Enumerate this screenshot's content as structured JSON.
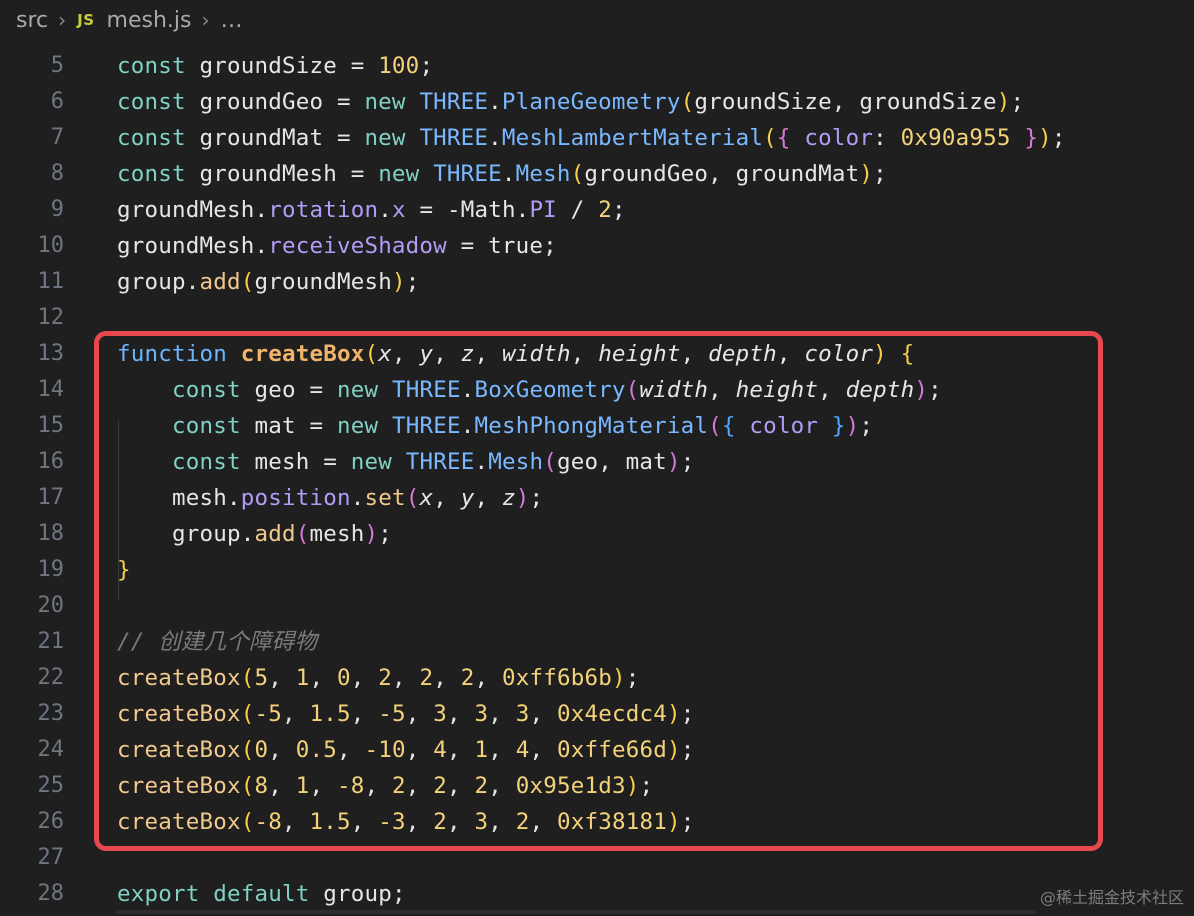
{
  "breadcrumb": {
    "folder": "src",
    "file_icon": "JS",
    "file": "mesh.js",
    "more": "…"
  },
  "colors": {
    "highlight_border": "#e5484d",
    "background": "#1f1f1f"
  },
  "lines": [
    {
      "n": "5",
      "tokens": [
        [
          "kw",
          "const"
        ],
        [
          "plain",
          " groundSize = "
        ],
        [
          "num",
          "100"
        ],
        [
          "plain",
          ";"
        ]
      ]
    },
    {
      "n": "6",
      "tokens": [
        [
          "kw",
          "const"
        ],
        [
          "plain",
          " groundGeo = "
        ],
        [
          "kw",
          "new"
        ],
        [
          "plain",
          " "
        ],
        [
          "cls",
          "THREE"
        ],
        [
          "plain",
          "."
        ],
        [
          "cls",
          "PlaneGeometry"
        ],
        [
          "b1",
          "("
        ],
        [
          "plain",
          "groundSize, groundSize"
        ],
        [
          "b1",
          ")"
        ],
        [
          "plain",
          ";"
        ]
      ]
    },
    {
      "n": "7",
      "tokens": [
        [
          "kw",
          "const"
        ],
        [
          "plain",
          " groundMat = "
        ],
        [
          "kw",
          "new"
        ],
        [
          "plain",
          " "
        ],
        [
          "cls",
          "THREE"
        ],
        [
          "plain",
          "."
        ],
        [
          "cls",
          "MeshLambertMaterial"
        ],
        [
          "b1",
          "("
        ],
        [
          "b2",
          "{"
        ],
        [
          "plain",
          " "
        ],
        [
          "prop",
          "color"
        ],
        [
          "plain",
          ": "
        ],
        [
          "num",
          "0x90a955"
        ],
        [
          "plain",
          " "
        ],
        [
          "b2",
          "}"
        ],
        [
          "b1",
          ")"
        ],
        [
          "plain",
          ";"
        ]
      ]
    },
    {
      "n": "8",
      "tokens": [
        [
          "kw",
          "const"
        ],
        [
          "plain",
          " groundMesh = "
        ],
        [
          "kw",
          "new"
        ],
        [
          "plain",
          " "
        ],
        [
          "cls",
          "THREE"
        ],
        [
          "plain",
          "."
        ],
        [
          "cls",
          "Mesh"
        ],
        [
          "b1",
          "("
        ],
        [
          "plain",
          "groundGeo, groundMat"
        ],
        [
          "b1",
          ")"
        ],
        [
          "plain",
          ";"
        ]
      ]
    },
    {
      "n": "9",
      "tokens": [
        [
          "plain",
          "groundMesh."
        ],
        [
          "prop",
          "rotation"
        ],
        [
          "plain",
          "."
        ],
        [
          "prop",
          "x"
        ],
        [
          "plain",
          " = "
        ],
        [
          "plain",
          "-Math."
        ],
        [
          "prop",
          "PI"
        ],
        [
          "plain",
          " / "
        ],
        [
          "num",
          "2"
        ],
        [
          "plain",
          ";"
        ]
      ]
    },
    {
      "n": "10",
      "tokens": [
        [
          "plain",
          "groundMesh."
        ],
        [
          "prop",
          "receiveShadow"
        ],
        [
          "plain",
          " = "
        ],
        [
          "plain",
          "true"
        ],
        [
          "plain",
          ";"
        ]
      ]
    },
    {
      "n": "11",
      "tokens": [
        [
          "plain",
          "group."
        ],
        [
          "call",
          "add"
        ],
        [
          "b1",
          "("
        ],
        [
          "plain",
          "groundMesh"
        ],
        [
          "b1",
          ")"
        ],
        [
          "plain",
          ";"
        ]
      ]
    },
    {
      "n": "12",
      "tokens": []
    },
    {
      "n": "13",
      "tokens": [
        [
          "fnkw",
          "function"
        ],
        [
          "plain",
          " "
        ],
        [
          "fn",
          "createBox"
        ],
        [
          "b1",
          "("
        ],
        [
          "param",
          "x"
        ],
        [
          "plain",
          ", "
        ],
        [
          "param",
          "y"
        ],
        [
          "plain",
          ", "
        ],
        [
          "param",
          "z"
        ],
        [
          "plain",
          ", "
        ],
        [
          "param",
          "width"
        ],
        [
          "plain",
          ", "
        ],
        [
          "param",
          "height"
        ],
        [
          "plain",
          ", "
        ],
        [
          "param",
          "depth"
        ],
        [
          "plain",
          ", "
        ],
        [
          "param",
          "color"
        ],
        [
          "b1",
          ")"
        ],
        [
          "plain",
          " "
        ],
        [
          "b1",
          "{"
        ]
      ]
    },
    {
      "n": "14",
      "tokens": [
        [
          "plain",
          "    "
        ],
        [
          "kw",
          "const"
        ],
        [
          "plain",
          " geo = "
        ],
        [
          "kw",
          "new"
        ],
        [
          "plain",
          " "
        ],
        [
          "cls",
          "THREE"
        ],
        [
          "plain",
          "."
        ],
        [
          "cls",
          "BoxGeometry"
        ],
        [
          "b2",
          "("
        ],
        [
          "param",
          "width"
        ],
        [
          "plain",
          ", "
        ],
        [
          "param",
          "height"
        ],
        [
          "plain",
          ", "
        ],
        [
          "param",
          "depth"
        ],
        [
          "b2",
          ")"
        ],
        [
          "plain",
          ";"
        ]
      ]
    },
    {
      "n": "15",
      "tokens": [
        [
          "plain",
          "    "
        ],
        [
          "kw",
          "const"
        ],
        [
          "plain",
          " mat = "
        ],
        [
          "kw",
          "new"
        ],
        [
          "plain",
          " "
        ],
        [
          "cls",
          "THREE"
        ],
        [
          "plain",
          "."
        ],
        [
          "cls",
          "MeshPhongMaterial"
        ],
        [
          "b2",
          "("
        ],
        [
          "b3",
          "{"
        ],
        [
          "plain",
          " "
        ],
        [
          "prop",
          "color"
        ],
        [
          "plain",
          " "
        ],
        [
          "b3",
          "}"
        ],
        [
          "b2",
          ")"
        ],
        [
          "plain",
          ";"
        ]
      ]
    },
    {
      "n": "16",
      "tokens": [
        [
          "plain",
          "    "
        ],
        [
          "kw",
          "const"
        ],
        [
          "plain",
          " mesh = "
        ],
        [
          "kw",
          "new"
        ],
        [
          "plain",
          " "
        ],
        [
          "cls",
          "THREE"
        ],
        [
          "plain",
          "."
        ],
        [
          "cls",
          "Mesh"
        ],
        [
          "b2",
          "("
        ],
        [
          "plain",
          "geo, mat"
        ],
        [
          "b2",
          ")"
        ],
        [
          "plain",
          ";"
        ]
      ]
    },
    {
      "n": "17",
      "tokens": [
        [
          "plain",
          "    mesh."
        ],
        [
          "prop",
          "position"
        ],
        [
          "plain",
          "."
        ],
        [
          "call",
          "set"
        ],
        [
          "b2",
          "("
        ],
        [
          "param",
          "x"
        ],
        [
          "plain",
          ", "
        ],
        [
          "param",
          "y"
        ],
        [
          "plain",
          ", "
        ],
        [
          "param",
          "z"
        ],
        [
          "b2",
          ")"
        ],
        [
          "plain",
          ";"
        ]
      ]
    },
    {
      "n": "18",
      "tokens": [
        [
          "plain",
          "    group."
        ],
        [
          "call",
          "add"
        ],
        [
          "b2",
          "("
        ],
        [
          "plain",
          "mesh"
        ],
        [
          "b2",
          ")"
        ],
        [
          "plain",
          ";"
        ]
      ]
    },
    {
      "n": "19",
      "tokens": [
        [
          "b1",
          "}"
        ]
      ]
    },
    {
      "n": "20",
      "tokens": []
    },
    {
      "n": "21",
      "tokens": [
        [
          "cmt",
          "// 创建几个障碍物"
        ]
      ]
    },
    {
      "n": "22",
      "tokens": [
        [
          "call",
          "createBox"
        ],
        [
          "b1",
          "("
        ],
        [
          "num",
          "5"
        ],
        [
          "plain",
          ", "
        ],
        [
          "num",
          "1"
        ],
        [
          "plain",
          ", "
        ],
        [
          "num",
          "0"
        ],
        [
          "plain",
          ", "
        ],
        [
          "num",
          "2"
        ],
        [
          "plain",
          ", "
        ],
        [
          "num",
          "2"
        ],
        [
          "plain",
          ", "
        ],
        [
          "num",
          "2"
        ],
        [
          "plain",
          ", "
        ],
        [
          "num",
          "0xff6b6b"
        ],
        [
          "b1",
          ")"
        ],
        [
          "plain",
          ";"
        ]
      ]
    },
    {
      "n": "23",
      "tokens": [
        [
          "call",
          "createBox"
        ],
        [
          "b1",
          "("
        ],
        [
          "num",
          "-5"
        ],
        [
          "plain",
          ", "
        ],
        [
          "num",
          "1.5"
        ],
        [
          "plain",
          ", "
        ],
        [
          "num",
          "-5"
        ],
        [
          "plain",
          ", "
        ],
        [
          "num",
          "3"
        ],
        [
          "plain",
          ", "
        ],
        [
          "num",
          "3"
        ],
        [
          "plain",
          ", "
        ],
        [
          "num",
          "3"
        ],
        [
          "plain",
          ", "
        ],
        [
          "num",
          "0x4ecdc4"
        ],
        [
          "b1",
          ")"
        ],
        [
          "plain",
          ";"
        ]
      ]
    },
    {
      "n": "24",
      "tokens": [
        [
          "call",
          "createBox"
        ],
        [
          "b1",
          "("
        ],
        [
          "num",
          "0"
        ],
        [
          "plain",
          ", "
        ],
        [
          "num",
          "0.5"
        ],
        [
          "plain",
          ", "
        ],
        [
          "num",
          "-10"
        ],
        [
          "plain",
          ", "
        ],
        [
          "num",
          "4"
        ],
        [
          "plain",
          ", "
        ],
        [
          "num",
          "1"
        ],
        [
          "plain",
          ", "
        ],
        [
          "num",
          "4"
        ],
        [
          "plain",
          ", "
        ],
        [
          "num",
          "0xffe66d"
        ],
        [
          "b1",
          ")"
        ],
        [
          "plain",
          ";"
        ]
      ]
    },
    {
      "n": "25",
      "tokens": [
        [
          "call",
          "createBox"
        ],
        [
          "b1",
          "("
        ],
        [
          "num",
          "8"
        ],
        [
          "plain",
          ", "
        ],
        [
          "num",
          "1"
        ],
        [
          "plain",
          ", "
        ],
        [
          "num",
          "-8"
        ],
        [
          "plain",
          ", "
        ],
        [
          "num",
          "2"
        ],
        [
          "plain",
          ", "
        ],
        [
          "num",
          "2"
        ],
        [
          "plain",
          ", "
        ],
        [
          "num",
          "2"
        ],
        [
          "plain",
          ", "
        ],
        [
          "num",
          "0x95e1d3"
        ],
        [
          "b1",
          ")"
        ],
        [
          "plain",
          ";"
        ]
      ]
    },
    {
      "n": "26",
      "tokens": [
        [
          "call",
          "createBox"
        ],
        [
          "b1",
          "("
        ],
        [
          "num",
          "-8"
        ],
        [
          "plain",
          ", "
        ],
        [
          "num",
          "1.5"
        ],
        [
          "plain",
          ", "
        ],
        [
          "num",
          "-3"
        ],
        [
          "plain",
          ", "
        ],
        [
          "num",
          "2"
        ],
        [
          "plain",
          ", "
        ],
        [
          "num",
          "3"
        ],
        [
          "plain",
          ", "
        ],
        [
          "num",
          "2"
        ],
        [
          "plain",
          ", "
        ],
        [
          "num",
          "0xf38181"
        ],
        [
          "b1",
          ")"
        ],
        [
          "plain",
          ";"
        ]
      ]
    },
    {
      "n": "27",
      "tokens": []
    },
    {
      "n": "28",
      "tokens": [
        [
          "kw",
          "export"
        ],
        [
          "plain",
          " "
        ],
        [
          "kw",
          "default"
        ],
        [
          "plain",
          " group;"
        ]
      ]
    }
  ],
  "watermark": "@稀土掘金技术社区"
}
